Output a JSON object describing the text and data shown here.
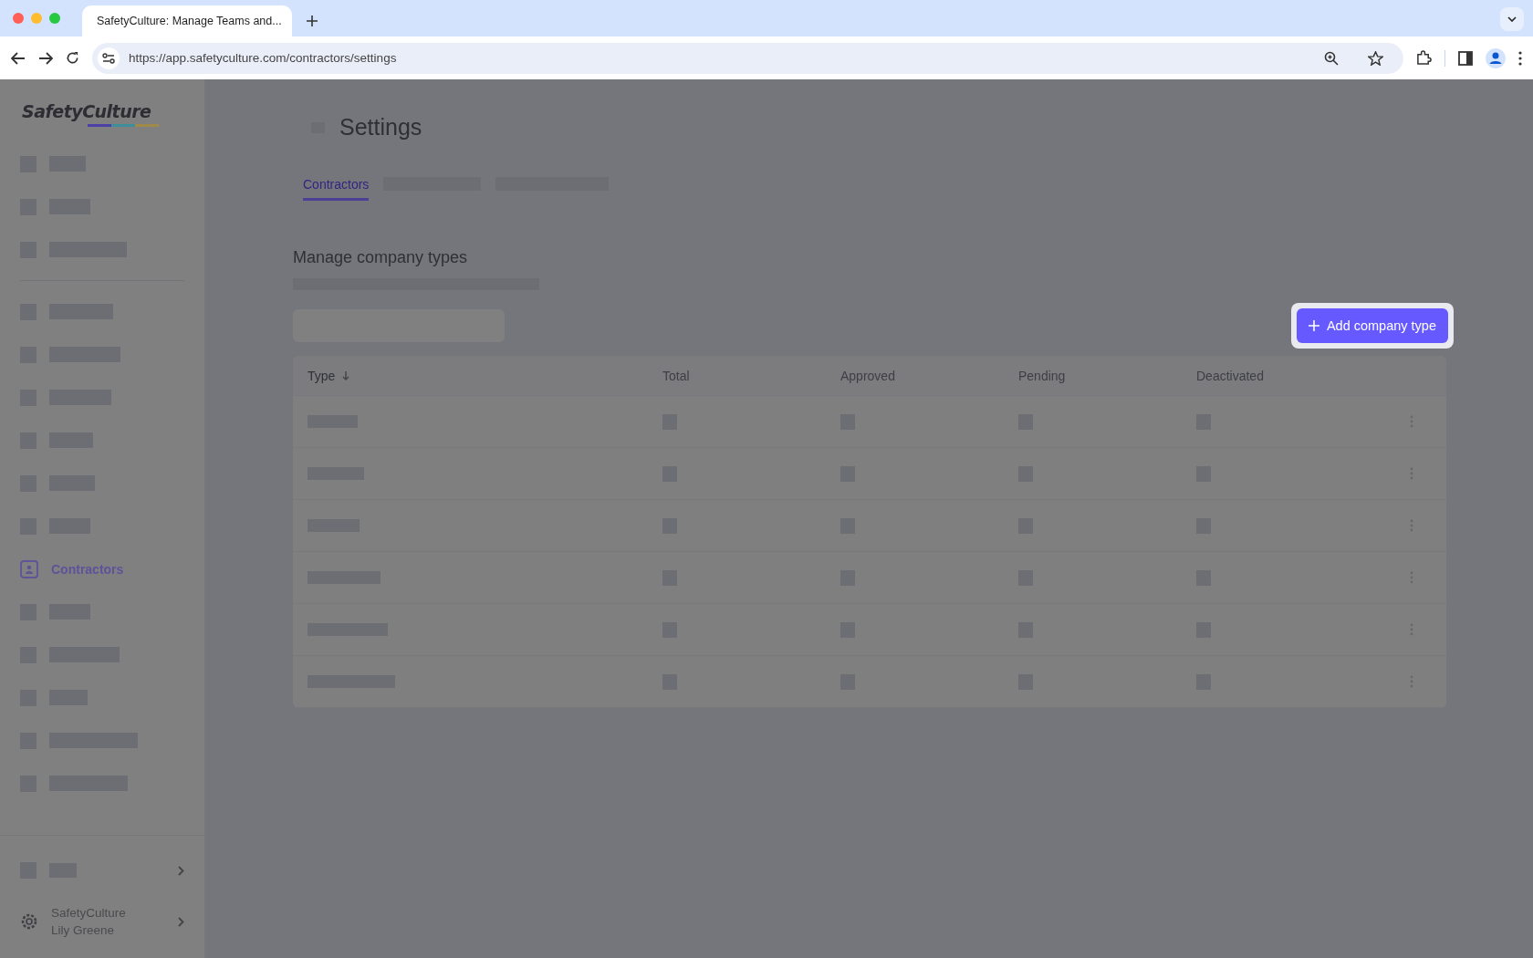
{
  "browser": {
    "tab_title": "SafetyCulture: Manage Teams and...",
    "url": "https://app.safetyculture.com/contractors/settings"
  },
  "sidebar": {
    "logo": "SafetyCulture",
    "items": [
      {
        "kind": "blurred",
        "selected": false
      },
      {
        "kind": "blurred",
        "selected": false
      },
      {
        "kind": "blurred",
        "selected": false
      },
      {
        "kind": "divider"
      },
      {
        "kind": "blurred",
        "selected": false
      },
      {
        "kind": "blurred",
        "selected": false
      },
      {
        "kind": "blurred",
        "selected": false
      },
      {
        "kind": "blurred",
        "selected": false
      },
      {
        "kind": "blurred",
        "selected": false
      },
      {
        "kind": "blurred",
        "selected": false
      },
      {
        "kind": "link",
        "label": "Contractors",
        "selected": true
      },
      {
        "kind": "blurred",
        "selected": false
      },
      {
        "kind": "blurred",
        "selected": false
      },
      {
        "kind": "blurred",
        "selected": false
      },
      {
        "kind": "blurred",
        "selected": false
      },
      {
        "kind": "blurred",
        "selected": false
      }
    ],
    "footer": {
      "org": "SafetyCulture",
      "user": "Lily Greene"
    }
  },
  "page": {
    "title": "Settings",
    "tabs": [
      {
        "kind": "text",
        "label": "Contractors",
        "selected": true
      },
      {
        "kind": "blurred",
        "selected": false
      },
      {
        "kind": "blurred",
        "selected": false
      }
    ],
    "section_title": "Manage company types",
    "add_button": "Add company type",
    "table": {
      "columns": [
        {
          "label": "Type",
          "sorted": true
        },
        {
          "label": "Total",
          "sorted": false
        },
        {
          "label": "Approved",
          "sorted": false
        },
        {
          "label": "Pending",
          "sorted": false
        },
        {
          "label": "Deactivated",
          "sorted": false
        }
      ]
    }
  }
}
